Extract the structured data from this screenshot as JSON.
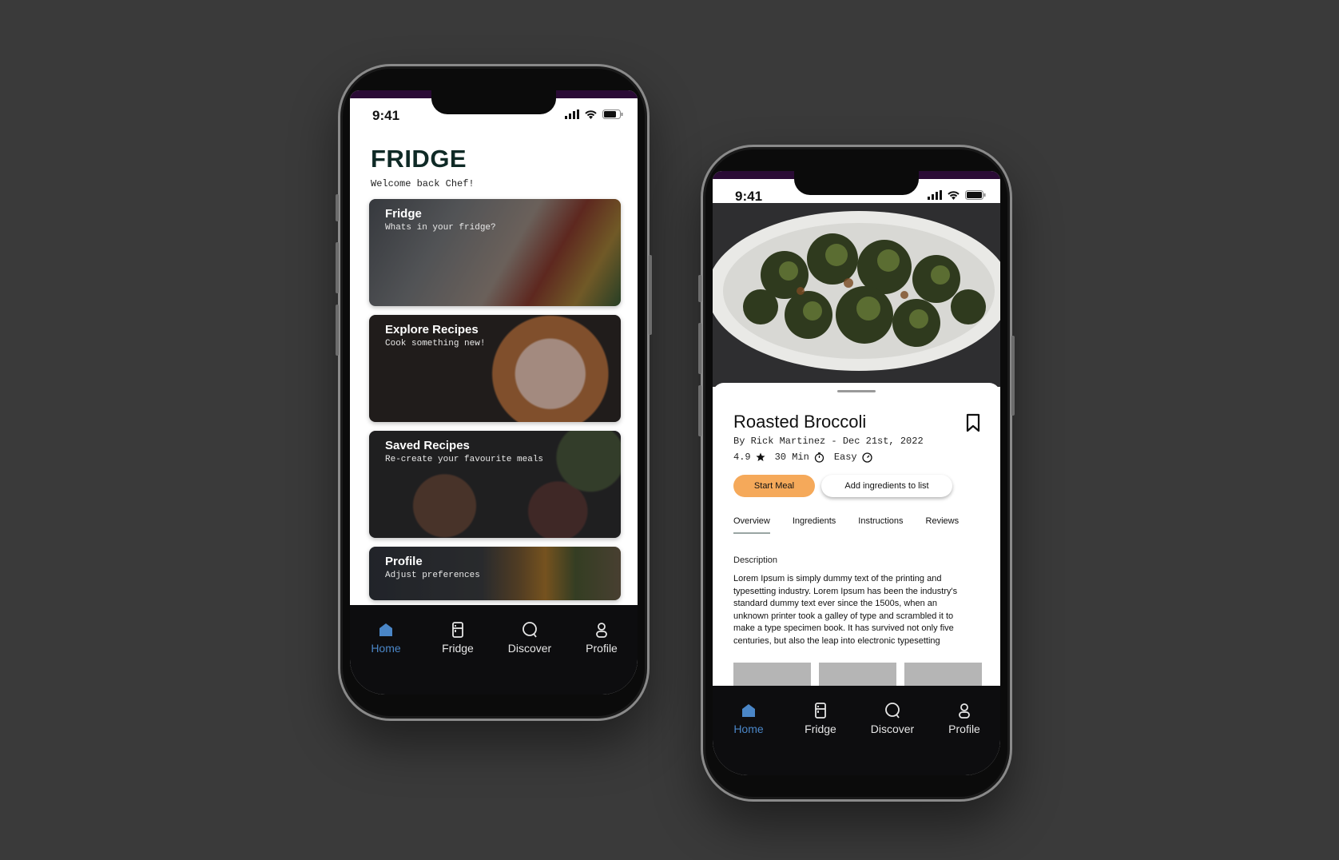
{
  "status": {
    "time": "9:41"
  },
  "fridge_screen": {
    "title": "FRIDGE",
    "subtitle": "Welcome back Chef!",
    "cards": [
      {
        "title": "Fridge",
        "subtitle": "Whats in your fridge?"
      },
      {
        "title": "Explore Recipes",
        "subtitle": "Cook something new!"
      },
      {
        "title": "Saved Recipes",
        "subtitle": "Re-create your favourite meals"
      },
      {
        "title": "Profile",
        "subtitle": "Adjust preferences"
      }
    ]
  },
  "nav": {
    "items": [
      {
        "label": "Home",
        "icon": "home-icon"
      },
      {
        "label": "Fridge",
        "icon": "fridge-icon"
      },
      {
        "label": "Discover",
        "icon": "search-icon"
      },
      {
        "label": "Profile",
        "icon": "person-icon"
      }
    ],
    "active": "Home",
    "active_color": "#4a86c7"
  },
  "recipe_screen": {
    "title": "Roasted Broccoli",
    "byline": "By Rick Martinez - Dec 21st, 2022",
    "rating": "4.9",
    "time": "30 Min",
    "difficulty": "Easy",
    "start_button": "Start Meal",
    "add_button": "Add ingredients to list",
    "tabs": [
      "Overview",
      "Ingredients",
      "Instructions",
      "Reviews"
    ],
    "active_tab": "Overview",
    "description_heading": "Description",
    "description": "Lorem Ipsum is simply dummy text of the printing and typesetting industry. Lorem Ipsum has been the industry's standard dummy text ever since the 1500s, when an unknown printer took a galley of type and scrambled it to make a type specimen book. It has survived not only five centuries, but also the leap into electronic typesetting",
    "accent_color": "#f5a95a"
  }
}
